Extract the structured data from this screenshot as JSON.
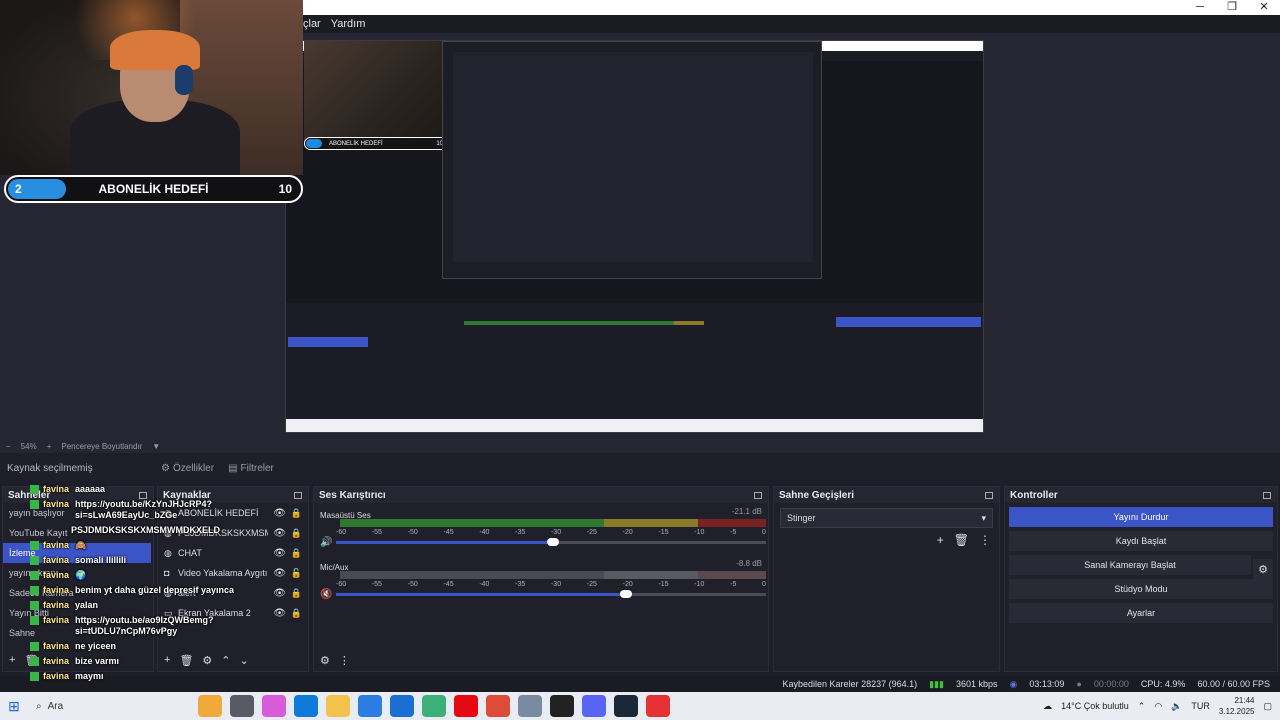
{
  "window": {
    "menu": [
      "çlar",
      "Yardım"
    ],
    "controls": [
      "─",
      "❐",
      "✕"
    ]
  },
  "goal": {
    "current": "2",
    "label": "ABONELİK HEDEFİ",
    "target": "10"
  },
  "nested_goal": {
    "current": "",
    "label": "ABONELİK HEDEFİ",
    "target": "10"
  },
  "preview_status": {
    "zoom": "54%",
    "mode": "Pencereye Boyutlandır"
  },
  "source_toolbar": {
    "label": "Kaynak seçilmemiş",
    "properties": "Özellikler",
    "filters": "Filtreler"
  },
  "scenes": {
    "title": "Sahneler",
    "items": [
      "yayın başlıyor",
      "YouTube Kayıt",
      "İzleme",
      "yayın ekranı",
      "Sadece Kamera",
      "Yayın Bitti",
      "Sahne"
    ],
    "active_index": 2
  },
  "sources": {
    "title": "Kaynaklar",
    "items": [
      {
        "label": "ABONELİK HEDEFİ",
        "icon": "globe-icon",
        "hidden": false,
        "locked": true
      },
      {
        "label": "PSJDMDKSKSKXMSMWMDKXELD",
        "icon": "globe-icon",
        "hidden": false,
        "locked": true
      },
      {
        "label": "CHAT",
        "icon": "globe-icon",
        "hidden": false,
        "locked": true
      },
      {
        "label": "Video Yakalama Aygıtı",
        "icon": "camera-icon",
        "hidden": false,
        "locked": false
      },
      {
        "label": "alert",
        "icon": "globe-icon",
        "hidden": false,
        "locked": true
      },
      {
        "label": "Ekran Yakalama 2",
        "icon": "monitor-icon",
        "hidden": false,
        "locked": true
      }
    ]
  },
  "mixer": {
    "title": "Ses Karıştırıcı",
    "channels": [
      {
        "name": "Masaüstü Ses",
        "db": "-21.1 dB",
        "level": 1.0,
        "volume": 0.6,
        "muted": false
      },
      {
        "name": "Mic/Aux",
        "db": "-8.8 dB",
        "level": 0.0,
        "volume": 0.68,
        "muted": true
      }
    ],
    "scale": [
      "-60",
      "-55",
      "-50",
      "-45",
      "-40",
      "-35",
      "-30",
      "-25",
      "-20",
      "-15",
      "-10",
      "-5",
      "0"
    ]
  },
  "transitions": {
    "title": "Sahne Geçişleri",
    "selected": "Stinger"
  },
  "controls": {
    "title": "Kontroller",
    "stop_stream": "Yayını Durdur",
    "start_record": "Kaydı Başlat",
    "virtual_cam": "Sanal Kamerayı Başlat",
    "studio_mode": "Stüdyo Modu",
    "settings": "Ayarlar"
  },
  "statusbar": {
    "dropped": "Kaybedilen Kareler 28237 (964.1)",
    "bitrate": "3601 kbps",
    "stream_time": "03:13:09",
    "record_time": "00:00:00",
    "cpu": "CPU: 4.9%",
    "fps": "60.00 / 60.00 FPS"
  },
  "chat": [
    {
      "user": "favina",
      "text": "aaaaaa"
    },
    {
      "user": "favina",
      "text": "https://youtu.be/KzYnJHJcRP4?si=sLwA69EayUc_bZGe"
    },
    {
      "user": "",
      "text": "PSJDMDKSKSKXMSMWMDKXELD"
    },
    {
      "user": "favina",
      "text": "🙈"
    },
    {
      "user": "favina",
      "text": "somali llillili"
    },
    {
      "user": "favina",
      "text": "🌍"
    },
    {
      "user": "favina",
      "text": "benim yt daha güzel depresif yayınca"
    },
    {
      "user": "favina",
      "text": "yalan"
    },
    {
      "user": "favina",
      "text": "https://youtu.be/ao9IzQWBemg?si=tUDLU7nCpM76vPgy"
    },
    {
      "user": "favina",
      "text": "ne yiceen"
    },
    {
      "user": "favina",
      "text": "bize varmı"
    },
    {
      "user": "favina",
      "text": "maymı"
    }
  ],
  "taskbar": {
    "search": "Ara",
    "weather": "14°C  Çok bulutlu",
    "lang": "TUR",
    "time": "21:44",
    "date": "3.12.2025",
    "apps": [
      {
        "name": "copilot-icon",
        "color": "#f2a93b"
      },
      {
        "name": "task-view-icon",
        "color": "#5a5a66"
      },
      {
        "name": "widgets-icon",
        "color": "#d85bd8"
      },
      {
        "name": "edge-icon",
        "color": "#0f7bd8"
      },
      {
        "name": "folder-icon",
        "color": "#f3c24a"
      },
      {
        "name": "store-icon",
        "color": "#2b7de0"
      },
      {
        "name": "mail-icon",
        "color": "#1a6fd0"
      },
      {
        "name": "photos-icon",
        "color": "#3db07a"
      },
      {
        "name": "netflix-icon",
        "color": "#e50914"
      },
      {
        "name": "chrome-icon",
        "color": "#dd4b39"
      },
      {
        "name": "settings-icon",
        "color": "#7a8aa0"
      },
      {
        "name": "obs-icon",
        "color": "#222222"
      },
      {
        "name": "discord-icon",
        "color": "#5865f2"
      },
      {
        "name": "steam-icon",
        "color": "#1b2838"
      },
      {
        "name": "app-red-icon",
        "color": "#e63232"
      }
    ]
  }
}
